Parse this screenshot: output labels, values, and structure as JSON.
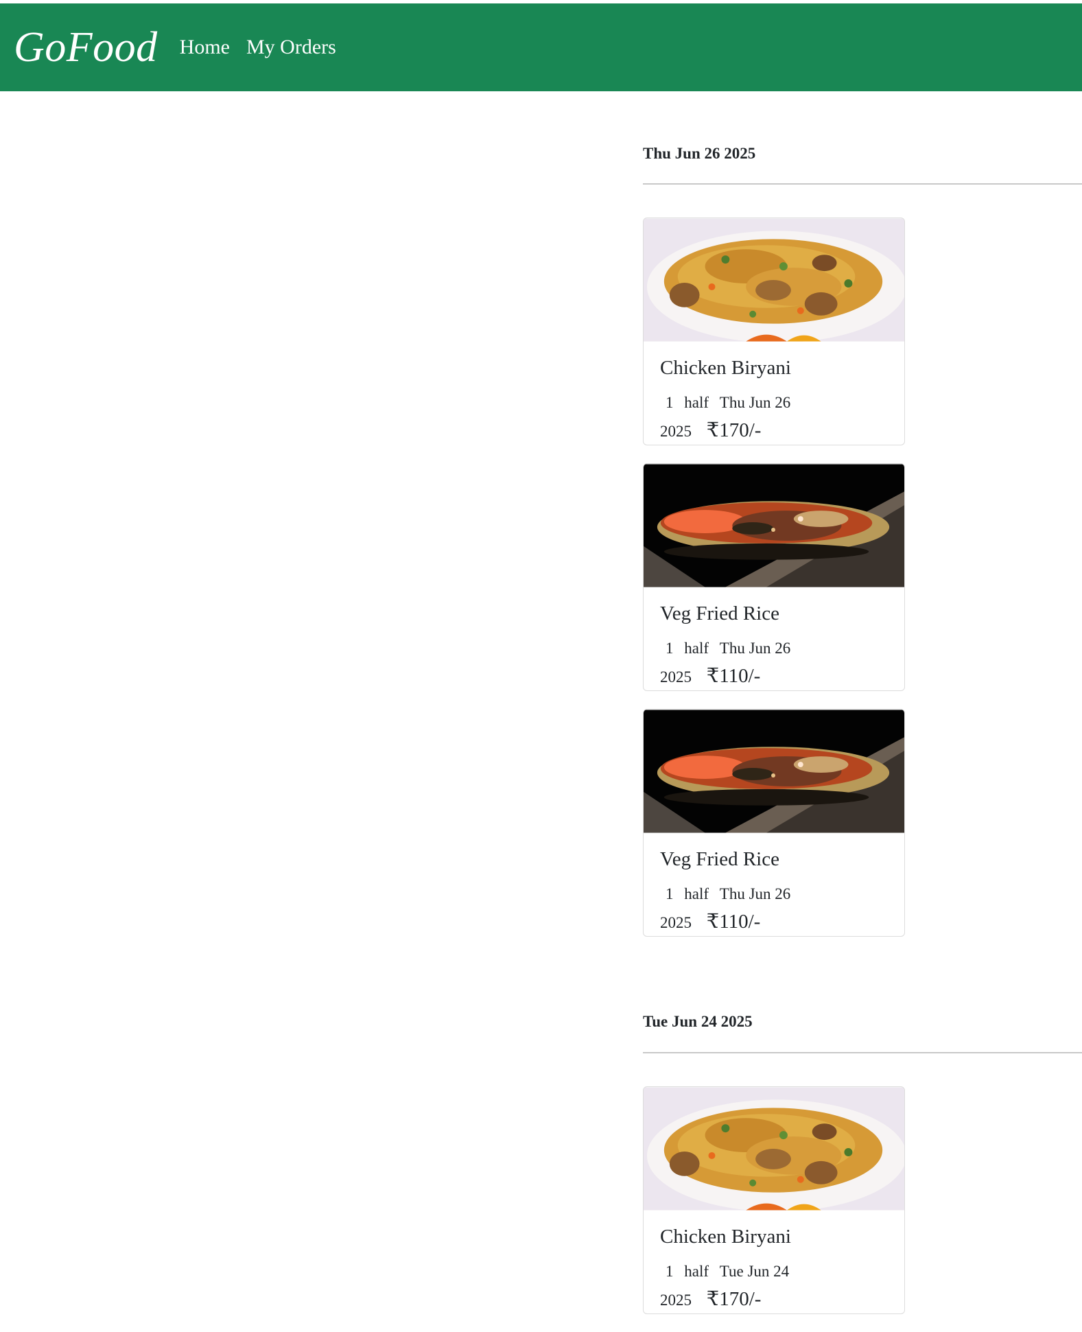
{
  "navbar": {
    "brand": "GoFood",
    "links": [
      "Home",
      "My Orders"
    ],
    "background_color": "#198754"
  },
  "orders": [
    {
      "date": "Thu Jun 26 2025",
      "items": [
        {
          "name": "Chicken Biryani",
          "qty": "1",
          "size": "half",
          "order_date_line1": "Thu Jun 26",
          "order_date_line2": "2025",
          "price": "₹170/-",
          "image": "biryani-image"
        },
        {
          "name": "Veg Fried Rice",
          "qty": "1",
          "size": "half",
          "order_date_line1": "Thu Jun 26",
          "order_date_line2": "2025",
          "price": "₹110/-",
          "image": "fried-rice-image"
        },
        {
          "name": "Veg Fried Rice",
          "qty": "1",
          "size": "half",
          "order_date_line1": "Thu Jun 26",
          "order_date_line2": "2025",
          "price": "₹110/-",
          "image": "fried-rice-image"
        }
      ]
    },
    {
      "date": "Tue Jun 24 2025",
      "items": [
        {
          "name": "Chicken Biryani",
          "qty": "1",
          "size": "half",
          "order_date_line1": "Tue Jun 24",
          "order_date_line2": "2025",
          "price": "₹170/-",
          "image": "biryani-image"
        }
      ]
    }
  ]
}
